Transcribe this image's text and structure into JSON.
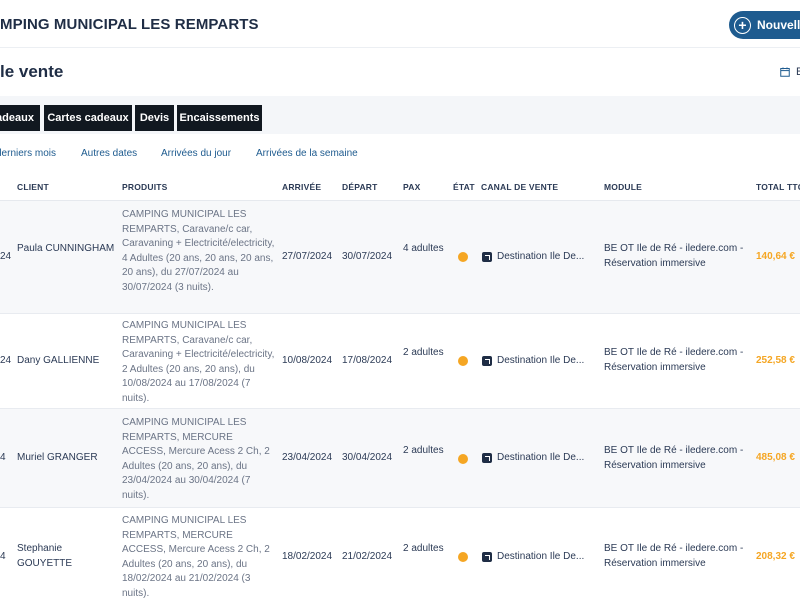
{
  "header": {
    "site_title": "MPING MUNICIPAL LES REMPARTS",
    "new_button_label": "Nouvelle"
  },
  "page": {
    "title": "le vente",
    "export_label": "E"
  },
  "tabs": [
    "adeaux",
    "Cartes cadeaux",
    "Devis",
    "Encaissements"
  ],
  "filters": [
    "derniers mois",
    "Autres dates",
    "Arrivées du jour",
    "Arrivées de la semaine"
  ],
  "table": {
    "headers": {
      "client": "CLIENT",
      "produits": "PRODUITS",
      "arrivee": "ARRIVÉE",
      "depart": "DÉPART",
      "pax": "PAX",
      "etat": "ÉTAT",
      "canal": "CANAL DE VENTE",
      "module": "MODULE",
      "total": "TOTAL TTC"
    },
    "rows": [
      {
        "date_prefix": "24",
        "client": "Paula CUNNINGHAM",
        "produits": "CAMPING MUNICIPAL LES REMPARTS, Caravane/c car, Caravaning + Electricité/electricity, 4 Adultes (20 ans, 20 ans, 20 ans, 20 ans), du 27/07/2024 au 30/07/2024 (3 nuits).",
        "arrivee": "27/07/2024",
        "depart": "30/07/2024",
        "pax": "4 adultes",
        "etat_color": "#f5a623",
        "canal": "Destination Ile De...",
        "module": "BE OT Ile de Ré - iledere.com - Réservation immersive",
        "total": "140,64 €"
      },
      {
        "date_prefix": "24",
        "client": "Dany GALLIENNE",
        "produits": "CAMPING MUNICIPAL LES REMPARTS, Caravane/c car, Caravaning + Electricité/electricity, 2 Adultes (20 ans, 20 ans), du 10/08/2024 au 17/08/2024 (7 nuits).",
        "arrivee": "10/08/2024",
        "depart": "17/08/2024",
        "pax": "2 adultes",
        "etat_color": "#f5a623",
        "canal": "Destination Ile De...",
        "module": "BE OT Ile de Ré - iledere.com - Réservation immersive",
        "total": "252,58 €"
      },
      {
        "date_prefix": "4",
        "client": "Muriel GRANGER",
        "produits": "CAMPING MUNICIPAL LES REMPARTS, MERCURE ACCESS, Mercure Acess 2 Ch, 2 Adultes (20 ans, 20 ans), du 23/04/2024 au 30/04/2024 (7 nuits).",
        "arrivee": "23/04/2024",
        "depart": "30/04/2024",
        "pax": "2 adultes",
        "etat_color": "#f5a623",
        "canal": "Destination Ile De...",
        "module": "BE OT Ile de Ré - iledere.com - Réservation immersive",
        "total": "485,08 €"
      },
      {
        "date_prefix": "4",
        "client": "Stephanie GOUYETTE",
        "produits": "CAMPING MUNICIPAL LES REMPARTS, MERCURE ACCESS, Mercure Acess 2 Ch, 2 Adultes (20 ans, 20 ans), du 18/02/2024 au 21/02/2024 (3 nuits).",
        "arrivee": "18/02/2024",
        "depart": "21/02/2024",
        "pax": "2 adultes",
        "etat_color": "#f5a623",
        "canal": "Destination Ile De...",
        "module": "BE OT Ile de Ré - iledere.com - Réservation immersive",
        "total": "208,32 €"
      }
    ]
  }
}
